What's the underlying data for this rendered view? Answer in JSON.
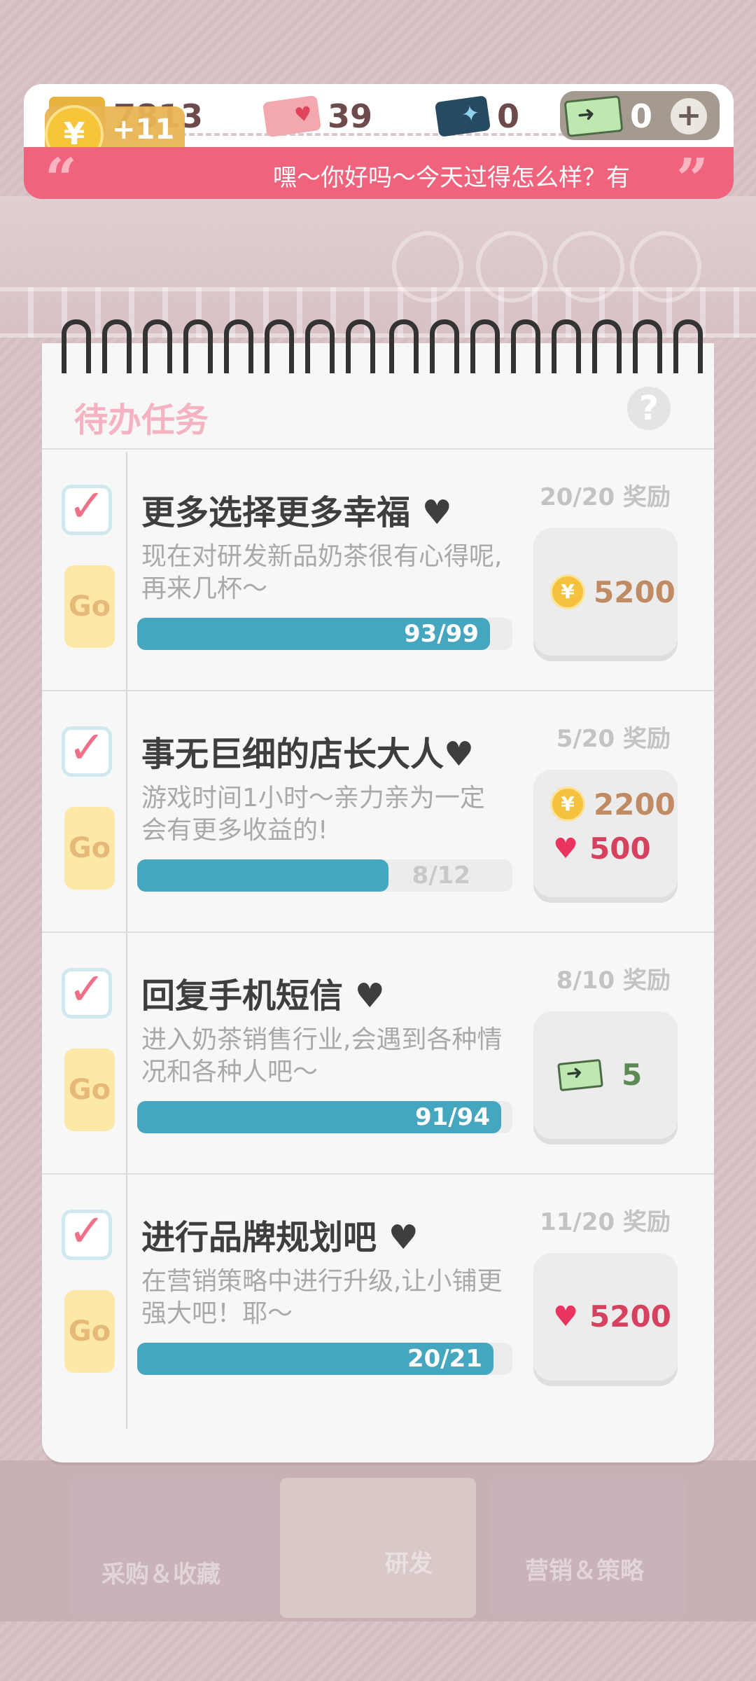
{
  "resources": {
    "coins": "7813",
    "hearts": "39",
    "tickets": "0",
    "cash": "0",
    "coin_gain": "+11"
  },
  "speech": {
    "text": "嘿～你好吗～今天过得怎么样？有"
  },
  "notebook": {
    "title": "待办任务"
  },
  "tasks": [
    {
      "title": "更多选择更多幸福 ♥",
      "desc": "现在对研发新品奶茶很有心得呢,再来几杯～",
      "progress_text": "93/99",
      "progress": 0.94,
      "reward_label": "20/20 奖励",
      "rewards": [
        {
          "icon": "coin-icon",
          "value": "5200",
          "color": "#c08a63"
        }
      ]
    },
    {
      "title": "事无巨细的店长大人♥",
      "desc": "游戏时间1小时～亲力亲为一定会有更多收益的!",
      "progress_text": "8/12",
      "progress": 0.67,
      "reward_label": "5/20 奖励",
      "rewards": [
        {
          "icon": "coin-icon",
          "value": "2200",
          "color": "#c08a63"
        },
        {
          "icon": "heart-icon",
          "value": "500",
          "color": "#d6415f"
        }
      ]
    },
    {
      "title": "回复手机短信 ♥",
      "desc": "进入奶茶销售行业,会遇到各种情况和各种人吧～",
      "progress_text": "91/94",
      "progress": 0.97,
      "reward_label": "8/10 奖励",
      "rewards": [
        {
          "icon": "cash-icon",
          "value": "5",
          "color": "#5c8a54"
        }
      ]
    },
    {
      "title": "进行品牌规划吧 ♥",
      "desc": "在营销策略中进行升级,让小铺更强大吧！耶～",
      "progress_text": "20/21",
      "progress": 0.95,
      "reward_label": "11/20 奖励",
      "rewards": [
        {
          "icon": "heart-icon",
          "value": "5200",
          "color": "#d6415f"
        }
      ]
    }
  ],
  "go_label": "Go",
  "bottom_tabs": [
    "采购＆收藏",
    "研发",
    "营销＆策略"
  ]
}
